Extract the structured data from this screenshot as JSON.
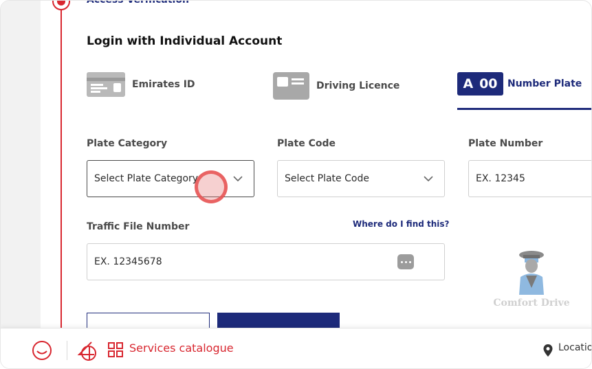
{
  "step": {
    "title": "Access Verification"
  },
  "heading": "Login with Individual Account",
  "methods": [
    {
      "label": "Emirates ID",
      "icon": "id-card-icon"
    },
    {
      "label": "Driving Licence",
      "icon": "driving-licence-icon"
    },
    {
      "label": "Number Plate",
      "icon": "number-plate-icon",
      "badge_left": "A",
      "badge_right": "00",
      "active": true
    }
  ],
  "form": {
    "plate_category": {
      "label": "Plate Category",
      "value": "Select Plate Category"
    },
    "plate_code": {
      "label": "Plate Code",
      "value": "Select Plate Code"
    },
    "plate_number": {
      "label": "Plate Number",
      "placeholder": "EX. 12345"
    },
    "traffic_file": {
      "label": "Traffic File Number",
      "placeholder": "EX. 12345678",
      "help_link": "Where do I find this?"
    }
  },
  "watermark": {
    "text": "Comfort Drive"
  },
  "bottom_bar": {
    "services_label": "Services catalogue",
    "location_label": "Locatio"
  },
  "colors": {
    "brand_red": "#d8262f",
    "brand_navy": "#1d2a7a"
  }
}
